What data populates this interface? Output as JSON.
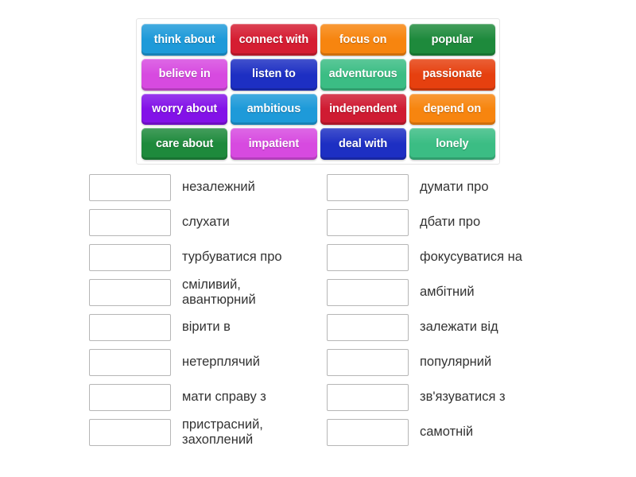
{
  "word_bank": {
    "tiles": [
      {
        "label": "think about",
        "color": "#1e9ad9"
      },
      {
        "label": "connect with",
        "color": "#d51d32"
      },
      {
        "label": "focus on",
        "color": "#f7850f"
      },
      {
        "label": "popular",
        "color": "#1e8a3c"
      },
      {
        "label": "believe in",
        "color": "#d74ae0"
      },
      {
        "label": "listen to",
        "color": "#1d2fc3"
      },
      {
        "label": "adventurous",
        "color": "#3bbd84"
      },
      {
        "label": "passionate",
        "color": "#e6400f"
      },
      {
        "label": "worry about",
        "color": "#8312e8"
      },
      {
        "label": "ambitious",
        "color": "#1e9ad9"
      },
      {
        "label": "independent",
        "color": "#cf1b32"
      },
      {
        "label": "depend on",
        "color": "#f7850f"
      },
      {
        "label": "care about",
        "color": "#1e8a3c"
      },
      {
        "label": "impatient",
        "color": "#d74ae0"
      },
      {
        "label": "deal with",
        "color": "#1d2fc3"
      },
      {
        "label": "lonely",
        "color": "#3bbd84"
      }
    ]
  },
  "answers": {
    "left_column": [
      {
        "slot_value": "",
        "label": "незалежний"
      },
      {
        "slot_value": "",
        "label": "слухати"
      },
      {
        "slot_value": "",
        "label": "турбуватися про"
      },
      {
        "slot_value": "",
        "label": "сміливий,\nавантюрний"
      },
      {
        "slot_value": "",
        "label": "вірити в"
      },
      {
        "slot_value": "",
        "label": "нетерплячий"
      },
      {
        "slot_value": "",
        "label": "мати справу з"
      },
      {
        "slot_value": "",
        "label": "пристрасний,\nзахоплений"
      }
    ],
    "right_column": [
      {
        "slot_value": "",
        "label": "думати про"
      },
      {
        "slot_value": "",
        "label": "дбати про"
      },
      {
        "slot_value": "",
        "label": "фокусуватися на"
      },
      {
        "slot_value": "",
        "label": "амбітний"
      },
      {
        "slot_value": "",
        "label": "залежати від"
      },
      {
        "slot_value": "",
        "label": "популярний"
      },
      {
        "slot_value": "",
        "label": "зв'язуватися з"
      },
      {
        "slot_value": "",
        "label": "самотній"
      }
    ]
  }
}
